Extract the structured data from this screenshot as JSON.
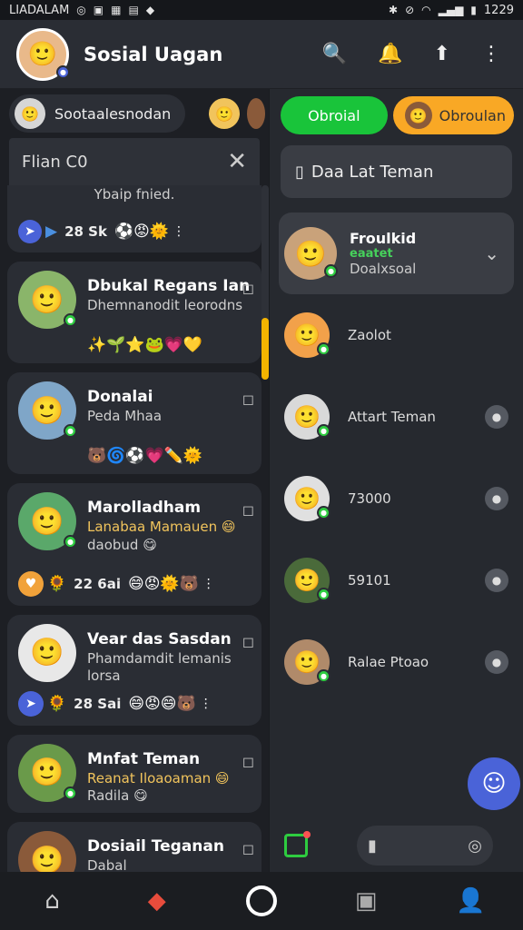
{
  "status_bar": {
    "carrier": "LIADALAM",
    "time": "1229",
    "battery": "▮"
  },
  "header": {
    "title": "Sosial Uagan"
  },
  "left": {
    "story_chip_label": "Sootaalesnodan",
    "search_label": "Flian C0",
    "chats": [
      {
        "name": "",
        "preview": "Ybaip fnied.",
        "count": "28 Sk",
        "emojis": "⚽😡🌞",
        "color": "#3a3d44"
      },
      {
        "name": "Dbukal Regans Ian",
        "preview": "Dhemnanodit leorodns",
        "emojis": "✨🌱⭐🐸💗💛",
        "color": "#5c8a3a"
      },
      {
        "name": "Donalai",
        "preview": "Peda Mhaa",
        "emojis": "🐻🌀⚽💗✏️🌞",
        "color": "#5a7fa0"
      },
      {
        "name": "Marolladham",
        "preview": "Lanabaa Mamauen 😄",
        "sub": "daobud 😋",
        "count": "22 6ai",
        "emojis": "😄😡🌞🐻",
        "color": "#4a8f52"
      },
      {
        "name": "Vear das Sasdan",
        "preview": "Phamdamdit lemanis",
        "sub": "lorsa",
        "count": "28 Sai",
        "emojis": "😄😡😄🐻",
        "color": "#d9d9d9"
      },
      {
        "name": "Mnfat Teman",
        "preview": "Reanat Iloaoaman 😄",
        "sub": "Radila 😋",
        "emojis": "",
        "color": "#6a9a4a"
      },
      {
        "name": "Dosiail Teganan",
        "preview": "Dabal",
        "emojis": "",
        "color": "#8a5a3a"
      }
    ]
  },
  "right": {
    "tab_green": "Obroial",
    "tab_orange": "Obroulan",
    "friends_button": "Daa Lat Teman",
    "expanded": {
      "name": "Froulkid",
      "status": "eaatet",
      "sub": "Doalxsoal"
    },
    "friends": [
      {
        "name": "Zaolot",
        "color": "#f2a14a"
      },
      {
        "name": "Attart Teman",
        "color": "#d9d9d9"
      },
      {
        "name": "73000",
        "color": "#e0e0e0"
      },
      {
        "name": "59101",
        "color": "#4a6a3a"
      },
      {
        "name": "Ralae Ptoao",
        "color": "#3a3d44"
      }
    ]
  },
  "icons": {
    "search": "🔍",
    "notify": "🔔",
    "upload": "⬆",
    "more": "⋮",
    "home": "⌂",
    "explore": "◆",
    "games": "▣",
    "profile": "👤"
  },
  "colors": {
    "accent_green": "#19c43a",
    "accent_orange": "#f9a825",
    "fab_blue": "#4a63d8",
    "scroll_gold": "#f4b400"
  }
}
